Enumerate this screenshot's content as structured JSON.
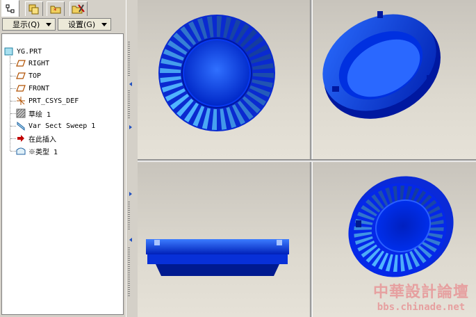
{
  "tabs": [
    {
      "icon": "model-tree-icon",
      "active": true
    },
    {
      "icon": "layers-icon",
      "active": false
    },
    {
      "icon": "folder-star-icon",
      "active": false
    },
    {
      "icon": "folder-tools-icon",
      "active": false
    }
  ],
  "toolbar": {
    "show_label": "显示(Q)",
    "settings_label": "设置(G)"
  },
  "tree": {
    "root": "YG.PRT",
    "items": [
      {
        "label": "RIGHT",
        "icon": "datum-plane-icon"
      },
      {
        "label": "TOP",
        "icon": "datum-plane-icon"
      },
      {
        "label": "FRONT",
        "icon": "datum-plane-icon"
      },
      {
        "label": "PRT_CSYS_DEF",
        "icon": "csys-icon"
      },
      {
        "label": "草绘 1",
        "icon": "sketch-icon"
      },
      {
        "label": "Var Sect Sweep 1",
        "icon": "sweep-icon"
      },
      {
        "label": "在此插入",
        "icon": "insert-arrow-icon"
      },
      {
        "label": "※类型 1",
        "icon": "surface-icon"
      }
    ]
  },
  "watermark": {
    "line1": "中華設計論壇",
    "line2": "bbs.chinade.net"
  },
  "colors": {
    "model_blue": "#0a3cf0",
    "panel_bg": "#d4d0c8",
    "insert_arrow": "#c00000"
  }
}
